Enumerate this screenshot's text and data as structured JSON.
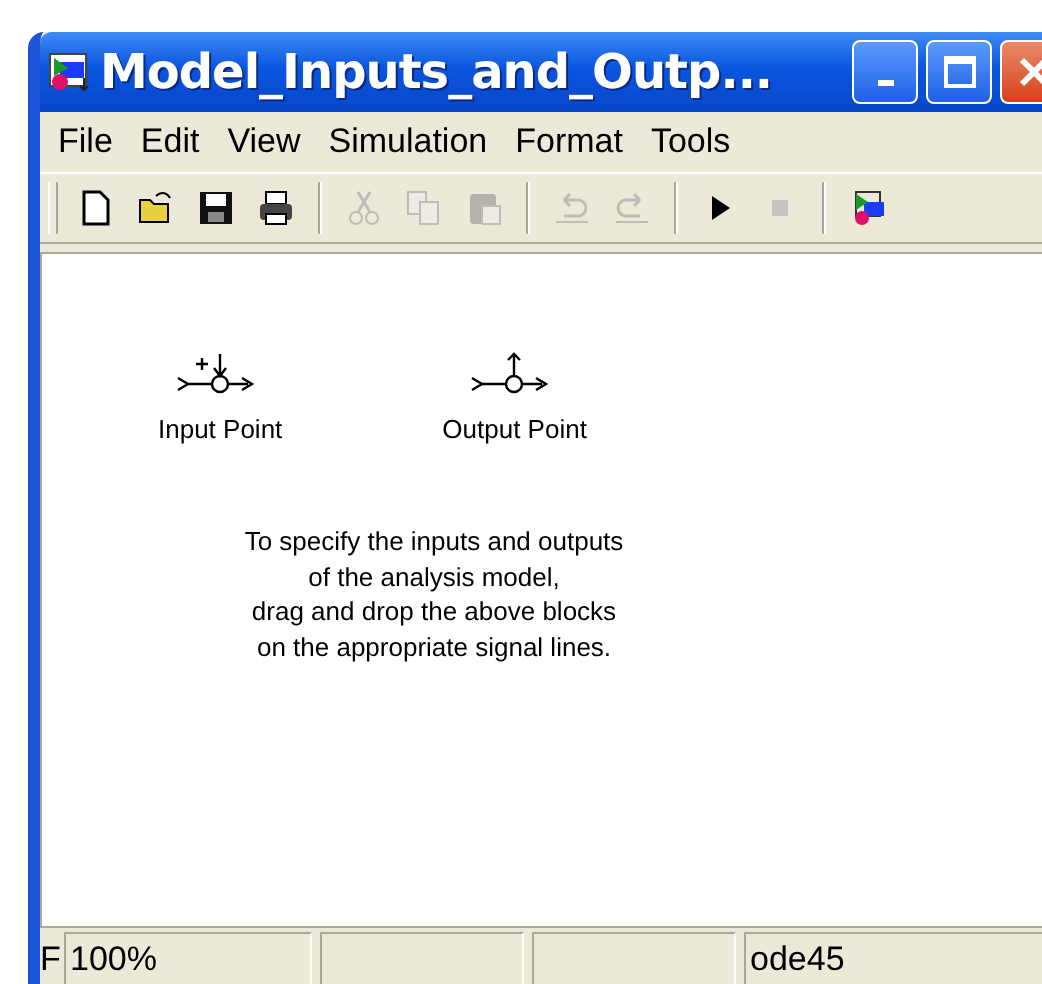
{
  "window": {
    "title": "Model_Inputs_and_Outp..."
  },
  "menu": [
    "File",
    "Edit",
    "View",
    "Simulation",
    "Format",
    "Tools"
  ],
  "toolbar": [
    {
      "kind": "new",
      "disabled": false
    },
    {
      "kind": "open",
      "disabled": false
    },
    {
      "kind": "save",
      "disabled": false
    },
    {
      "kind": "print",
      "disabled": false
    },
    {
      "kind": "sep"
    },
    {
      "kind": "cut",
      "disabled": true
    },
    {
      "kind": "copy",
      "disabled": true
    },
    {
      "kind": "paste",
      "disabled": true
    },
    {
      "kind": "sep"
    },
    {
      "kind": "undo",
      "disabled": true
    },
    {
      "kind": "redo",
      "disabled": true
    },
    {
      "kind": "sep"
    },
    {
      "kind": "play",
      "disabled": false
    },
    {
      "kind": "stop",
      "disabled": true
    },
    {
      "kind": "sep"
    },
    {
      "kind": "library",
      "disabled": false
    }
  ],
  "blocks": [
    {
      "kind": "input",
      "label": "Input Point"
    },
    {
      "kind": "output",
      "label": "Output Point"
    }
  ],
  "note": "To specify the inputs and outputs\nof the analysis model,\ndrag and drop the above blocks\non the appropriate signal lines.",
  "status_bar": {
    "left": "F",
    "zoom": "100%",
    "solver": "ode45"
  }
}
